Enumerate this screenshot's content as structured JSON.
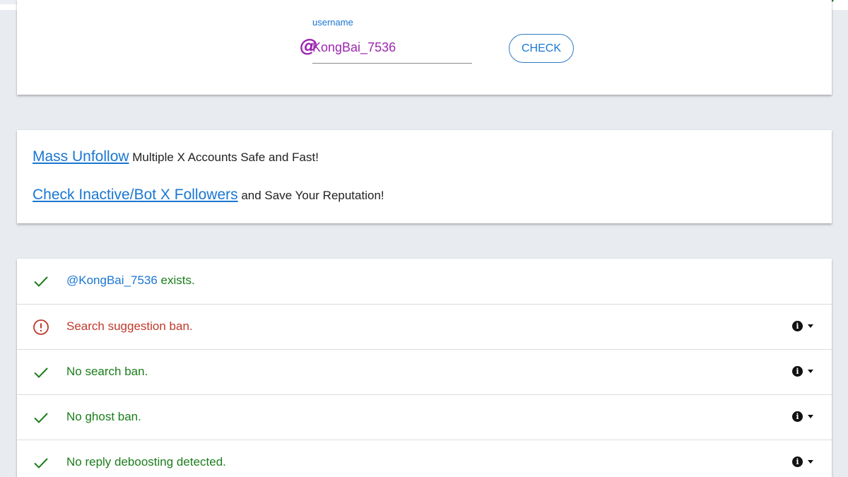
{
  "form": {
    "label": "username",
    "at_symbol": "@",
    "value": "KongBai_7536",
    "check_label": "CHECK"
  },
  "promo": {
    "line1_link": "Mass Unfollow",
    "line1_text": " Multiple X Accounts Safe and Fast!",
    "line2_link": "Check Inactive/Bot X Followers",
    "line2_text": " and Save Your Reputation!"
  },
  "results": {
    "exists_handle": "@KongBai_7536",
    "exists_text": " exists.",
    "items": [
      {
        "text": "Search suggestion ban.",
        "status": "warning"
      },
      {
        "text": "No search ban.",
        "status": "ok"
      },
      {
        "text": "No ghost ban.",
        "status": "ok"
      },
      {
        "text": "No reply deboosting detected.",
        "status": "ok"
      }
    ]
  },
  "colors": {
    "ok": "#1b7d1b",
    "warning": "#c0392b",
    "accent": "#1976d2",
    "handle_purple": "#9c27b0"
  },
  "icons": {
    "ok": "check-icon",
    "warning": "error-circle-icon",
    "info": "info-icon",
    "dropdown": "caret-down-icon"
  }
}
